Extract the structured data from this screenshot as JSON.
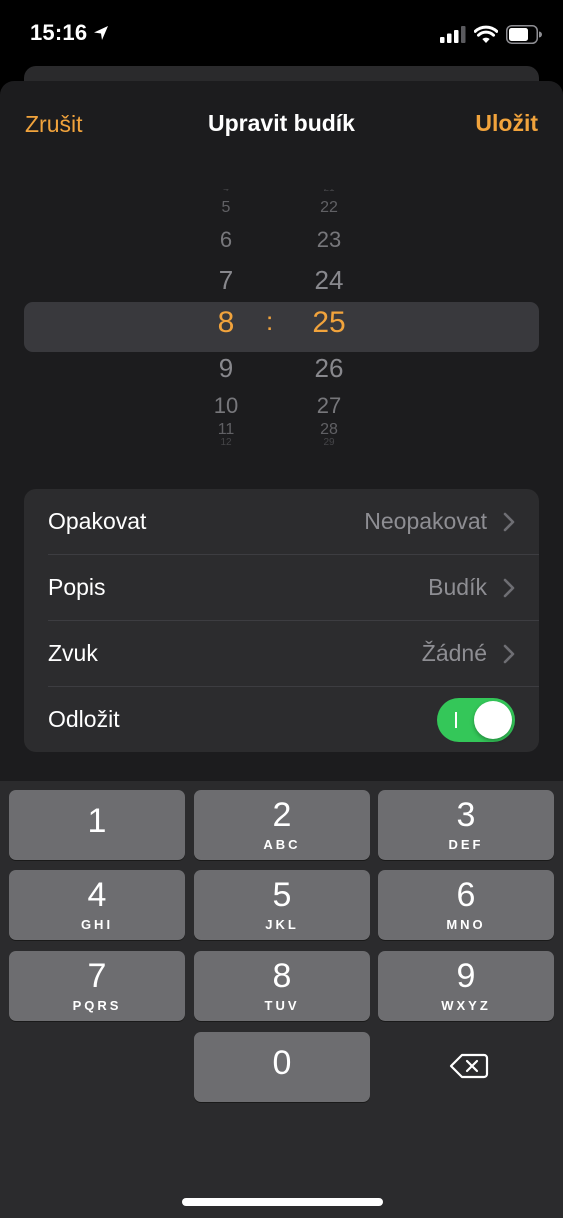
{
  "status_bar": {
    "time": "15:16",
    "icons": [
      "location-arrow-icon",
      "cellular-signal-icon",
      "wifi-icon",
      "battery-icon"
    ]
  },
  "nav": {
    "cancel_label": "Zrušit",
    "title": "Upravit budík",
    "save_label": "Uložit"
  },
  "picker": {
    "hours": [
      "4",
      "5",
      "6",
      "7",
      "8",
      "9",
      "10",
      "11",
      "12"
    ],
    "minutes": [
      "21",
      "22",
      "23",
      "24",
      "25",
      "26",
      "27",
      "28",
      "29"
    ],
    "selected_hour": "8",
    "separator": ":",
    "selected_minute": "25"
  },
  "settings": {
    "repeat": {
      "label": "Opakovat",
      "value": "Neopakovat"
    },
    "description": {
      "label": "Popis",
      "value": "Budík"
    },
    "sound": {
      "label": "Zvuk",
      "value": "Žádné"
    },
    "snooze": {
      "label": "Odložit",
      "enabled": true
    }
  },
  "keypad": {
    "keys": [
      {
        "digit": "1",
        "letters": ""
      },
      {
        "digit": "2",
        "letters": "ABC"
      },
      {
        "digit": "3",
        "letters": "DEF"
      },
      {
        "digit": "4",
        "letters": "GHI"
      },
      {
        "digit": "5",
        "letters": "JKL"
      },
      {
        "digit": "6",
        "letters": "MNO"
      },
      {
        "digit": "7",
        "letters": "PQRS"
      },
      {
        "digit": "8",
        "letters": "TUV"
      },
      {
        "digit": "9",
        "letters": "WXYZ"
      },
      {
        "digit": "0",
        "letters": ""
      }
    ],
    "backspace_icon": "backspace-icon"
  },
  "colors": {
    "accent": "#f1a33c",
    "toggle_on": "#34c759",
    "sheet_bg": "#1c1c1e",
    "group_bg": "#2c2c2e",
    "key_bg": "#6d6d70"
  }
}
